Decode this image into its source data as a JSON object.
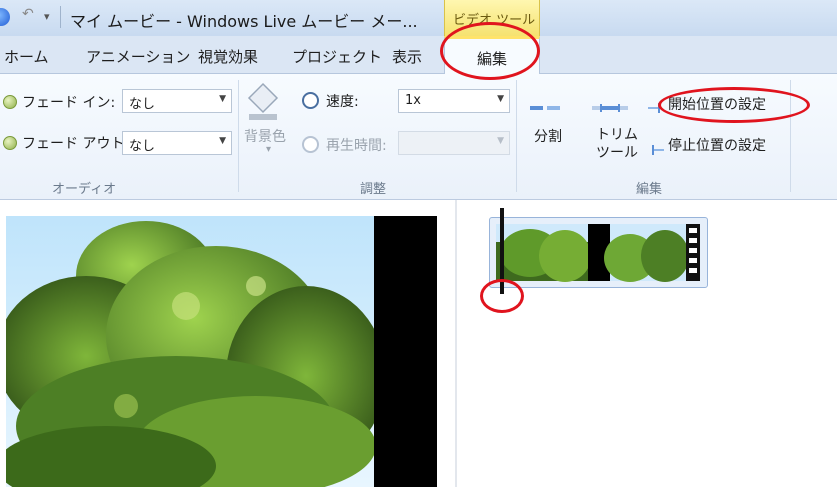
{
  "titlebar": {
    "title": "マイ ムービー - Windows Live ムービー メー...",
    "contextual_tab_group": "ビデオ ツール"
  },
  "tabs": {
    "home": "ホーム",
    "animation": "アニメーション",
    "visual_effects": "視覚効果",
    "project": "プロジェクト",
    "view": "表示",
    "edit": "編集"
  },
  "ribbon": {
    "audio": {
      "fade_in_label": "フェード イン:",
      "fade_in_value": "なし",
      "fade_out_label": "フェード アウト:",
      "fade_out_value": "なし",
      "group_label": "オーディオ"
    },
    "adjust": {
      "background_color_label": "背景色",
      "speed_label": "速度:",
      "speed_value": "1x",
      "duration_label": "再生時間:",
      "duration_value": "",
      "group_label": "調整"
    },
    "edit": {
      "split_label": "分割",
      "trim_tool_line1": "トリム",
      "trim_tool_line2": "ツール",
      "set_start_point": "開始位置の設定",
      "set_end_point": "停止位置の設定",
      "group_label": "編集"
    }
  },
  "icons": {
    "app": "movie-maker-app-icon",
    "undo": "undo-icon",
    "qat_dropdown": "dropdown-arrow-icon",
    "fade_in": "fade-in-icon",
    "fade_out": "fade-out-icon",
    "background_color": "paint-bucket-icon",
    "speed": "speed-clock-icon",
    "duration": "duration-clock-icon",
    "split": "split-icon",
    "trim_tool": "trim-icon",
    "set_start": "set-start-point-icon",
    "set_end": "set-end-point-icon"
  },
  "colors": {
    "annotation_red": "#e0141e",
    "contextual_tab_yellow": "#f5e270",
    "ribbon_blue": "#dbe6f4"
  }
}
